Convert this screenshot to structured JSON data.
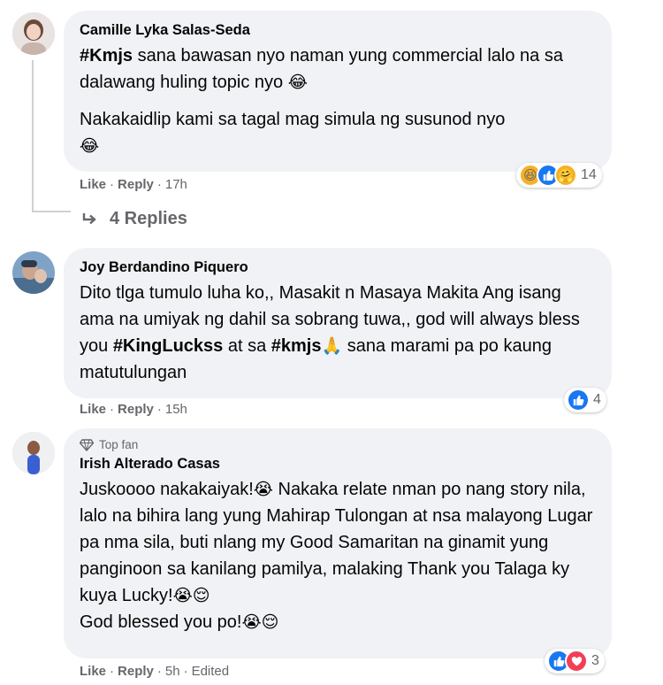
{
  "comments": [
    {
      "author": "Camille Lyka Salas-Seda",
      "paragraph1_hashtag": "#Kmjs",
      "paragraph1_text": " sana bawasan nyo naman yung commercial lalo na sa dalawang huling topic nyo ",
      "paragraph1_emoji": "😂",
      "paragraph2_text": "Nakakaidlip kami sa tagal mag simula ng susunod nyo",
      "paragraph2_emoji": "😂",
      "like": "Like",
      "reply": "Reply",
      "time": "17h",
      "reaction_count": "14",
      "reaction_icons": [
        "haha",
        "like",
        "care"
      ],
      "replies_label": "4 Replies"
    },
    {
      "author": "Joy Berdandino Piquero",
      "text_a": "Dito tlga tumulo luha ko,, Masakit n Masaya Makita Ang isang ama na umiyak ng dahil sa sobrang tuwa,, god will always bless you ",
      "hashtag1": "#KingLuckss",
      "text_b": " at sa ",
      "hashtag2": "#kmjs",
      "emoji": "🙏",
      "text_c": " sana marami pa po kaung matutulungan",
      "like": "Like",
      "reply": "Reply",
      "time": "15h",
      "reaction_count": "4",
      "reaction_icons": [
        "like"
      ]
    },
    {
      "badge": "Top fan",
      "author": "Irish Alterado Casas",
      "text_a": "Juskoooo nakakaiyak!",
      "emoji1": "😭",
      "text_b": " Nakaka relate nman po nang story nila, lalo na bihira lang yung Mahirap Tulongan at nsa malayong Lugar pa nma sila, buti nlang my Good Samaritan na ginamit yung panginoon sa kanilang pamilya, malaking Thank you Talaga ky kuya Lucky!",
      "emoji2": "😭😌",
      "text_c": "God blessed you po!",
      "emoji3": "😭😌",
      "like": "Like",
      "reply": "Reply",
      "time": "5h",
      "edited": "Edited",
      "reaction_count": "3",
      "reaction_icons": [
        "like",
        "love"
      ]
    }
  ],
  "colors": {
    "bubble": "#f0f2f5",
    "meta_text": "#65676b",
    "like_blue": "#1877f2",
    "love_red": "#f33e58",
    "haha_yellow": "#f7b125"
  }
}
